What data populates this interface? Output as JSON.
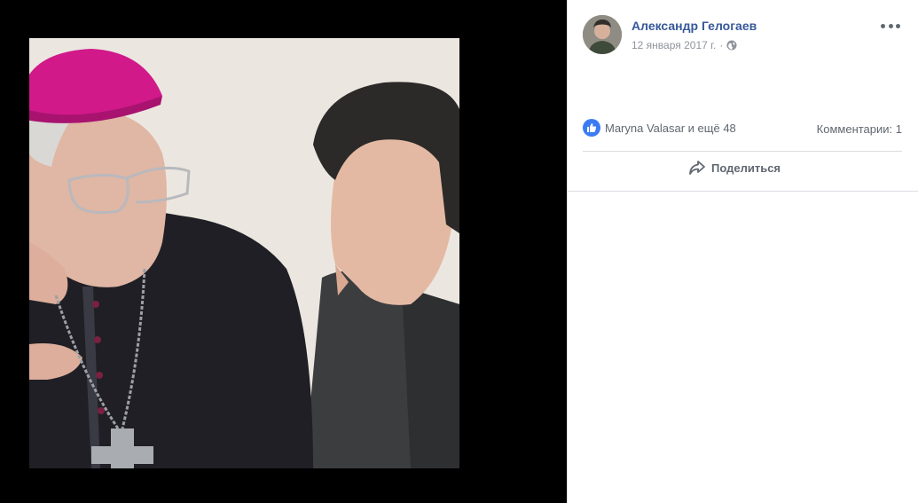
{
  "photo": {
    "image": "photo-two-men-talking",
    "background": "#eae6df"
  },
  "post": {
    "author": "Александр Гелогаев",
    "date": "12 января 2017 г.",
    "separator": "·",
    "privacy_icon": "globe-icon",
    "more_icon": "more-options-icon"
  },
  "reactions": {
    "icon": "like-icon",
    "text": "Maryna Valasar и ещё 48",
    "comments": "Комментарии: 1"
  },
  "actions": {
    "share_icon": "share-arrow-icon",
    "share_label": "Поделиться"
  },
  "colors": {
    "link": "#365899",
    "meta": "#90949c",
    "like": "#3b7cf4",
    "viewer_bg": "#000000"
  }
}
